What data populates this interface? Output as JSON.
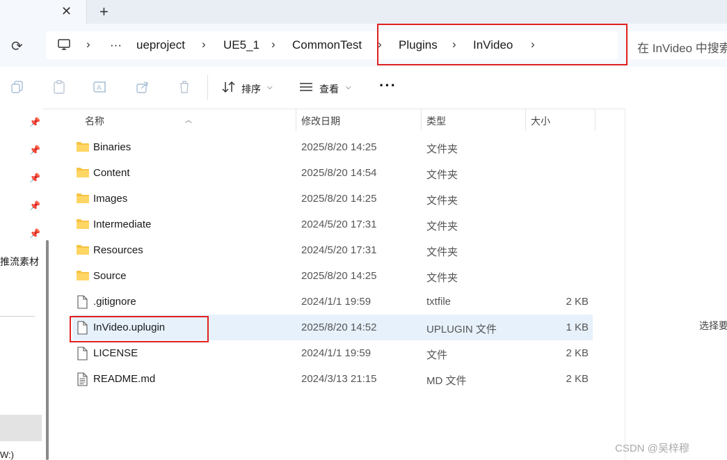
{
  "tab": {
    "close_icon": "close-icon",
    "new_tab_icon": "plus-icon"
  },
  "nav": {
    "refresh_icon": "refresh-icon",
    "breadcrumbs": [
      "ueproject",
      "UE5_1",
      "CommonTest",
      "Plugins",
      "InVideo"
    ],
    "overflow": "···",
    "search_placeholder": "在 InVideo 中搜索"
  },
  "toolbar": {
    "sort_label": "排序",
    "view_label": "查看",
    "more_label": "···"
  },
  "leftnav": {
    "quick_access_label": "推流素材",
    "drive_label": "W:)"
  },
  "columns": {
    "name": "名称",
    "date": "修改日期",
    "type": "类型",
    "size": "大小"
  },
  "files": [
    {
      "name": "Binaries",
      "date": "2025/8/20 14:25",
      "type": "文件夹",
      "size": "",
      "icon": "folder-icon"
    },
    {
      "name": "Content",
      "date": "2025/8/20 14:54",
      "type": "文件夹",
      "size": "",
      "icon": "folder-icon"
    },
    {
      "name": "Images",
      "date": "2025/8/20 14:25",
      "type": "文件夹",
      "size": "",
      "icon": "folder-icon"
    },
    {
      "name": "Intermediate",
      "date": "2024/5/20 17:31",
      "type": "文件夹",
      "size": "",
      "icon": "folder-icon"
    },
    {
      "name": "Resources",
      "date": "2024/5/20 17:31",
      "type": "文件夹",
      "size": "",
      "icon": "folder-icon"
    },
    {
      "name": "Source",
      "date": "2025/8/20 14:25",
      "type": "文件夹",
      "size": "",
      "icon": "folder-icon"
    },
    {
      "name": ".gitignore",
      "date": "2024/1/1 19:59",
      "type": "txtfile",
      "size": "2 KB",
      "icon": "file-icon"
    },
    {
      "name": "InVideo.uplugin",
      "date": "2025/8/20 14:52",
      "type": "UPLUGIN 文件",
      "size": "1 KB",
      "icon": "file-icon"
    },
    {
      "name": "LICENSE",
      "date": "2024/1/1 19:59",
      "type": "文件",
      "size": "2 KB",
      "icon": "file-icon"
    },
    {
      "name": "README.md",
      "date": "2024/3/13 21:15",
      "type": "MD 文件",
      "size": "2 KB",
      "icon": "text-file-icon"
    }
  ],
  "selected_file": "InVideo.uplugin",
  "preview": {
    "message": "选择要"
  },
  "watermark": "CSDN @吴梓穆",
  "colors": {
    "highlight_box": "#e02020",
    "folder": "#f6c343",
    "selection": "#e7f1fb"
  }
}
